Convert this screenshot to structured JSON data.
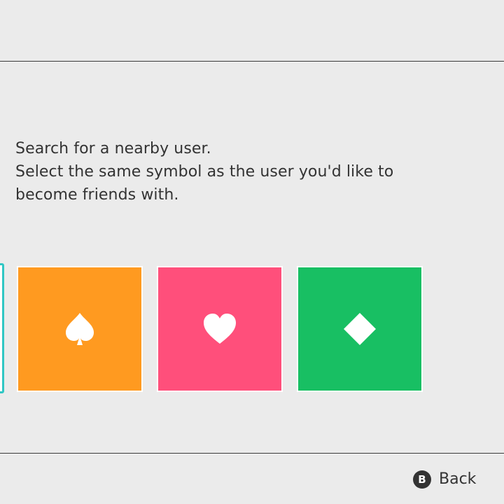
{
  "instructions": {
    "line1": "Search for a nearby user.",
    "line2": "Select the same symbol as the user you'd like to",
    "line3": "become friends with."
  },
  "symbols": [
    {
      "name": "spade",
      "icon": "spade-icon",
      "color": "#ff9a20"
    },
    {
      "name": "heart",
      "icon": "heart-icon",
      "color": "#ff4f7b"
    },
    {
      "name": "diamond",
      "icon": "diamond-icon",
      "color": "#18bf63"
    }
  ],
  "selection": {
    "highlight_color": "#30c7c4"
  },
  "footer": {
    "back_button_glyph": "B",
    "back_label": "Back"
  }
}
